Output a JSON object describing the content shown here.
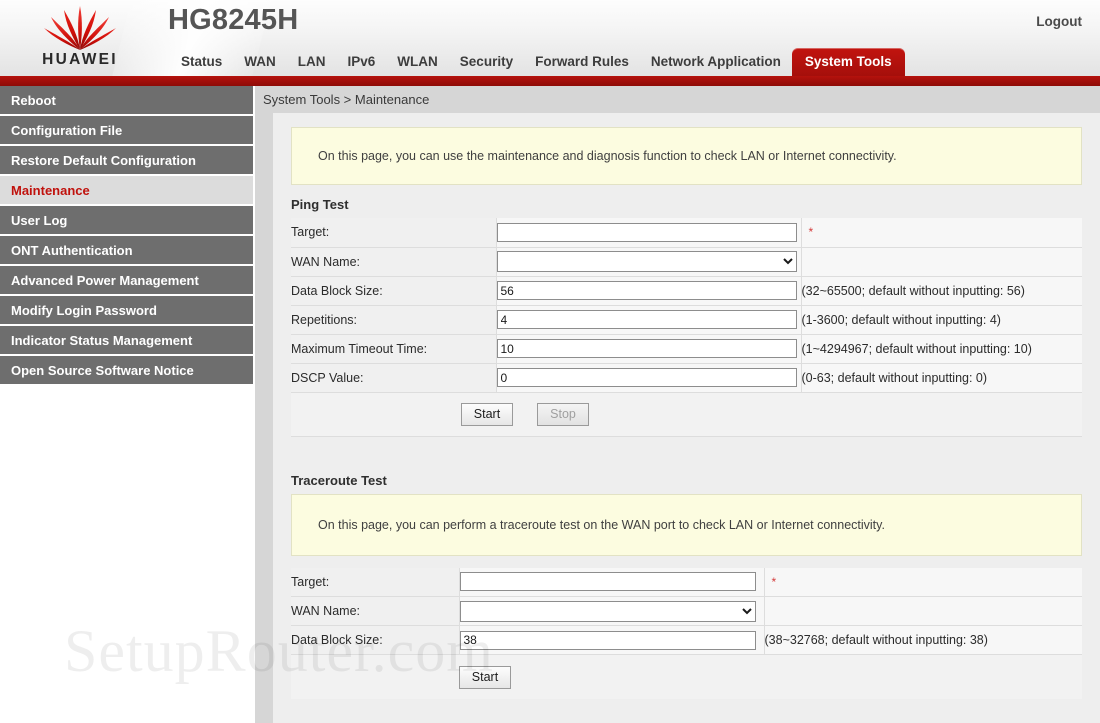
{
  "header": {
    "brand": "HUAWEI",
    "device_model": "HG8245H",
    "logout_label": "Logout",
    "logo_icon": "huawei-flower-logo",
    "accent_red": "#b5120d",
    "tabs": [
      {
        "label": "Status",
        "active": false
      },
      {
        "label": "WAN",
        "active": false
      },
      {
        "label": "LAN",
        "active": false
      },
      {
        "label": "IPv6",
        "active": false
      },
      {
        "label": "WLAN",
        "active": false
      },
      {
        "label": "Security",
        "active": false
      },
      {
        "label": "Forward Rules",
        "active": false
      },
      {
        "label": "Network Application",
        "active": false
      },
      {
        "label": "System Tools",
        "active": true
      }
    ]
  },
  "sidebar": {
    "items": [
      {
        "label": "Reboot",
        "active": false
      },
      {
        "label": "Configuration File",
        "active": false
      },
      {
        "label": "Restore Default Configuration",
        "active": false
      },
      {
        "label": "Maintenance",
        "active": true
      },
      {
        "label": "User Log",
        "active": false
      },
      {
        "label": "ONT Authentication",
        "active": false
      },
      {
        "label": "Advanced Power Management",
        "active": false
      },
      {
        "label": "Modify Login Password",
        "active": false
      },
      {
        "label": "Indicator Status Management",
        "active": false
      },
      {
        "label": "Open Source Software Notice",
        "active": false
      }
    ]
  },
  "breadcrumb": "System Tools > Maintenance",
  "page_notice": "On this page, you can use the maintenance and diagnosis function to check LAN or Internet connectivity.",
  "ping_test": {
    "title": "Ping Test",
    "rows": [
      {
        "label": "Target:",
        "type": "text",
        "value": "",
        "required": true,
        "hint": ""
      },
      {
        "label": "WAN Name:",
        "type": "select",
        "value": "",
        "required": false,
        "hint": ""
      },
      {
        "label": "Data Block Size:",
        "type": "text",
        "value": "56",
        "required": false,
        "hint": "(32~65500; default without inputting: 56)"
      },
      {
        "label": "Repetitions:",
        "type": "text",
        "value": "4",
        "required": false,
        "hint": "(1-3600; default without inputting: 4)"
      },
      {
        "label": "Maximum Timeout Time:",
        "type": "text",
        "value": "10",
        "required": false,
        "hint": "(1~4294967; default without inputting: 10)"
      },
      {
        "label": "DSCP Value:",
        "type": "text",
        "value": "0",
        "required": false,
        "hint": "(0-63; default without inputting: 0)"
      }
    ],
    "start_label": "Start",
    "stop_label": "Stop",
    "stop_disabled": true
  },
  "traceroute_test": {
    "title": "Traceroute Test",
    "notice": "On this page, you can perform a traceroute test on the WAN port to check LAN or Internet connectivity.",
    "rows": [
      {
        "label": "Target:",
        "type": "text",
        "value": "",
        "required": true,
        "hint": ""
      },
      {
        "label": "WAN Name:",
        "type": "select",
        "value": "",
        "required": false,
        "hint": ""
      },
      {
        "label": "Data Block Size:",
        "type": "text",
        "value": "38",
        "required": false,
        "hint": "(38~32768; default without inputting: 38)"
      }
    ],
    "start_label": "Start"
  },
  "watermark": "SetupRouter.com"
}
